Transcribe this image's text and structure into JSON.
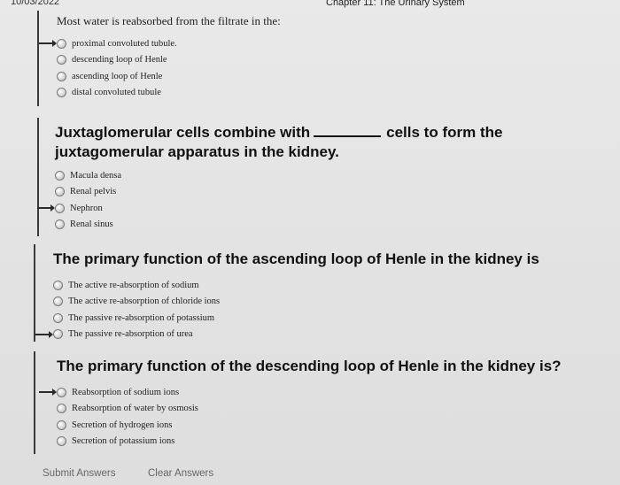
{
  "header": {
    "left_fragment": "10/03/2022",
    "chapter_title": "Chapter 11: The Urinary System"
  },
  "questions": [
    {
      "text": "Most water is reabsorbed from the filtrate in the:",
      "options": [
        "proximal convoluted tubule.",
        "descending loop of Henle",
        "ascending loop of Henle",
        "distal convoluted tubule"
      ],
      "selected_index": 0
    },
    {
      "text_part1": "Juxtaglomerular cells combine with",
      "text_part2": "cells to form the",
      "text_part3": "juxtagomerular apparatus in the kidney.",
      "options": [
        "Macula densa",
        "Renal pelvis",
        "Nephron",
        "Renal sinus"
      ],
      "selected_index": 2
    },
    {
      "text": "The primary function of the ascending loop of Henle in the kidney is",
      "options": [
        "The active re-absorption of sodium",
        "The active re-absorption of chloride ions",
        "The passive re-absorption of potassium",
        "The passive re-absorption of urea"
      ],
      "selected_index": 3
    },
    {
      "text": "The primary function of the descending loop of Henle in the kidney is?",
      "options": [
        "Reabsorption of sodium ions",
        "Reabsorption of water by osmosis",
        "Secretion of hydrogen ions",
        "Secretion of potassium ions"
      ],
      "selected_index": 0
    }
  ],
  "footer": {
    "submit_label": "Submit Answers",
    "clear_label": "Clear Answers"
  }
}
